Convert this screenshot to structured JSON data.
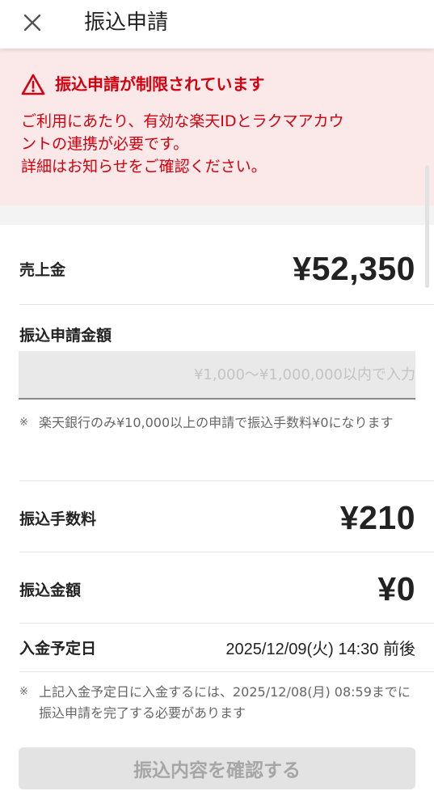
{
  "header": {
    "close_icon": "close-icon",
    "title": "振込申請"
  },
  "alert": {
    "icon": "warning-icon",
    "title": "振込申請が制限されています",
    "message_line1": "ご利用にあたり、有効な楽天IDとラクマアカウ",
    "message_line2": "ントの連携が必要です。",
    "message_line3": "詳細はお知らせをご確認ください。",
    "color": "#d5000e",
    "background": "#fbe9ea"
  },
  "sales": {
    "label": "売上金",
    "amount": "¥52,350"
  },
  "transfer_request": {
    "label": "振込申請金額",
    "input_value": "",
    "input_placeholder": "¥1,000〜¥1,000,000以内で入力",
    "note_mark": "※",
    "note": "楽天銀行のみ¥10,000以上の申請で振込手数料¥0になります"
  },
  "fee": {
    "label": "振込手数料",
    "amount": "¥210"
  },
  "transfer_amount": {
    "label": "振込金額",
    "amount": "¥0"
  },
  "deposit_date": {
    "label": "入金予定日",
    "value": "2025/12/09(火) 14:30 前後",
    "note_mark": "※",
    "note": "上記入金予定日に入金するには、2025/12/08(月) 08:59までに振込申請を完了する必要があります"
  },
  "confirm_button": {
    "label": "振込内容を確認する",
    "state": "disabled"
  }
}
